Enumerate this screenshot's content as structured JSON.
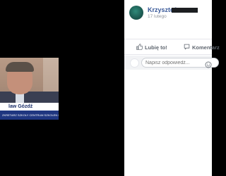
{
  "post": {
    "author": "Krzysztof",
    "time": "17 lutego"
  },
  "media": {
    "chyron_name": "law Gózdź",
    "ticker_text": "ZKRETARZ SZKOLY CENTRUM SZKOLEN I W KIELCACH"
  },
  "actions": {
    "like_label": "Lubię to!",
    "comment_label": "Komentarz"
  },
  "reply": {
    "placeholder": "Napisz odpowiedź..."
  },
  "colors": {
    "author": "#385898",
    "action_text": "#606770",
    "chyron_text": "#1b2f6b",
    "ticker_bg": "#1f3680"
  },
  "icons": {
    "like": "thumbs-up-icon",
    "comment": "comment-bubble-icon",
    "emoji": "smiley-icon"
  }
}
